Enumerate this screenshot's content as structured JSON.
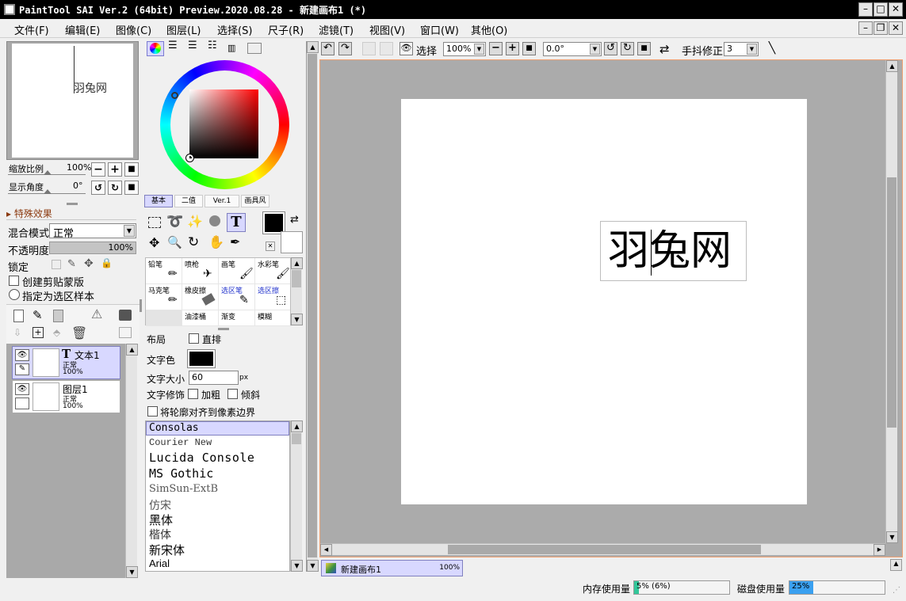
{
  "window": {
    "title": "PaintTool SAI Ver.2 (64bit) Preview.2020.08.28 - 新建画布1 (*)"
  },
  "menu": [
    "文件(F)",
    "编辑(E)",
    "图像(C)",
    "图层(L)",
    "选择(S)",
    "尺子(R)",
    "滤镜(T)",
    "视图(V)",
    "窗口(W)",
    "其他(O)"
  ],
  "navigator": {
    "preview_text": "羽兔网",
    "zoom_label": "缩放比例",
    "zoom_value": "100%",
    "angle_label": "显示角度",
    "angle_value": "0°"
  },
  "layer_props": {
    "effects": "特殊效果",
    "blend_label": "混合模式",
    "blend_value": "正常",
    "opacity_label": "不透明度",
    "opacity_value": "100%",
    "lock_label": "锁定",
    "clip_label": "创建剪贴蒙版",
    "sample_label": "指定为选区样本"
  },
  "layers": [
    {
      "name": "文本1",
      "mode": "正常",
      "opacity": "100%",
      "type_icon": "T"
    },
    {
      "name": "图层1",
      "mode": "正常",
      "opacity": "100%"
    }
  ],
  "color_tabs": [
    "基本",
    "二值",
    "Ver.1",
    "画具风"
  ],
  "brushes": [
    [
      "铅笔",
      "喷枪",
      "画笔",
      "水彩笔"
    ],
    [
      "马克笔",
      "橡皮擦",
      "选区笔",
      "选区擦"
    ],
    [
      "",
      "油漆桶",
      "渐变",
      "模糊"
    ]
  ],
  "text_tool": {
    "layout_label": "布局",
    "vertical_label": "直排",
    "color_label": "文字色",
    "size_label": "文字大小",
    "size_value": "60",
    "size_unit": "px",
    "style_label": "文字修饰",
    "bold_label": "加粗",
    "italic_label": "倾斜",
    "align_label": "将轮廓对齐到像素边界"
  },
  "fonts": [
    "Consolas",
    "Courier New",
    "Lucida Console",
    "MS Gothic",
    "SimSun-ExtB",
    "仿宋",
    "黑体",
    "楷体",
    "新宋体",
    "Arial"
  ],
  "toolbar": {
    "select_label": "选择",
    "zoom": "100%",
    "angle": "0.0°",
    "stabilizer_label": "手抖修正",
    "stabilizer_value": "3"
  },
  "canvas": {
    "text": "羽兔网"
  },
  "doc_tab": {
    "name": "新建画布1",
    "zoom": "100%"
  },
  "status": {
    "mem_label": "内存使用量",
    "mem_value": "5% (6%)",
    "mem_fraction": 0.05,
    "disk_label": "磁盘使用量",
    "disk_value": "25%",
    "disk_fraction": 0.25
  }
}
